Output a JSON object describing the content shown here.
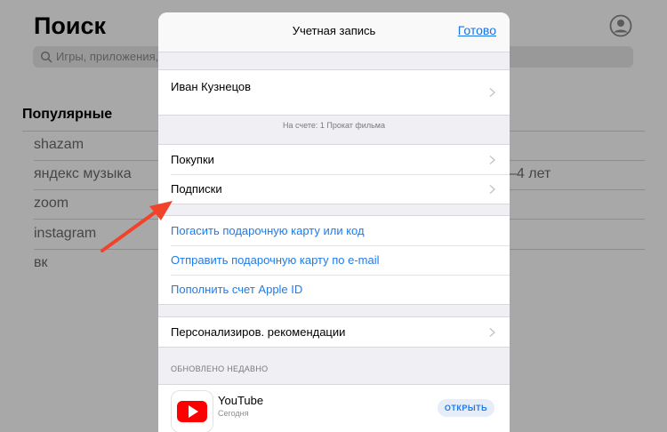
{
  "background": {
    "title": "Поиск",
    "search_placeholder": "Игры, приложения,",
    "popular_heading": "Популярные",
    "trending": [
      "shazam",
      "яндекс музыка",
      "zoom",
      "instagram",
      "вк"
    ],
    "right_text": "–4 лет"
  },
  "sheet": {
    "title": "Учетная запись",
    "done_label": "Готово",
    "account_name": "Иван Кузнецов",
    "balance_note": "На счете: 1 Прокат фильма",
    "purchases_label": "Покупки",
    "subscriptions_label": "Подписки",
    "redeem_label": "Погасить подарочную карту или код",
    "send_gift_label": "Отправить подарочную карту по e-mail",
    "add_funds_label": "Пополнить счет Apple ID",
    "personalized_label": "Персонализиров. рекомендации",
    "recently_updated_label": "ОБНОВЛЕНО НЕДАВНО",
    "recent_app": {
      "name": "YouTube",
      "subtitle": "Сегодня",
      "action_label": "ОТКРЫТЬ"
    }
  },
  "colors": {
    "accent": "#1f7bea",
    "annotation_arrow": "#f0432b",
    "youtube_red": "#ff0000"
  }
}
